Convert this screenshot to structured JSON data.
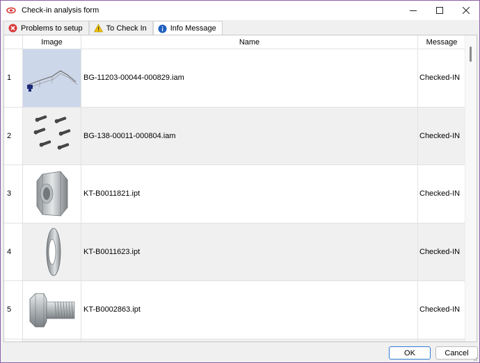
{
  "window": {
    "title": "Check-in analysis form",
    "controls": {
      "minimize": "—",
      "maximize": "☐",
      "close": "✕"
    }
  },
  "tabs": [
    {
      "label": "Problems to setup",
      "icon": "error-icon",
      "color": "#d83b3b"
    },
    {
      "label": "To Check In",
      "icon": "warning-icon",
      "color": "#f2c200"
    },
    {
      "label": "Info Message",
      "icon": "info-icon",
      "color": "#1e5fbf",
      "selected": true
    }
  ],
  "table": {
    "headers": {
      "image": "Image",
      "name": "Name",
      "message": "Message"
    },
    "rows": [
      {
        "index": "1",
        "name": "BG-11203-00044-000829.iam",
        "message": "Checked-IN",
        "thumbnail": "assembly-rail-icon"
      },
      {
        "index": "2",
        "name": "BG-138-00011-000804.iam",
        "message": "Checked-IN",
        "thumbnail": "bolt-set-icon"
      },
      {
        "index": "3",
        "name": "KT-B0011821.ipt",
        "message": "Checked-IN",
        "thumbnail": "hex-nut-icon"
      },
      {
        "index": "4",
        "name": "KT-B0011623.ipt",
        "message": "Checked-IN",
        "thumbnail": "washer-icon"
      },
      {
        "index": "5",
        "name": "KT-B0002863.ipt",
        "message": "Checked-IN",
        "thumbnail": "hex-bolt-icon"
      }
    ]
  },
  "buttons": {
    "ok": "OK",
    "cancel": "Cancel"
  },
  "colors": {
    "accent": "#2d7ed6",
    "selection": "#ccd7ea",
    "alt_row": "#f0f0f0"
  }
}
